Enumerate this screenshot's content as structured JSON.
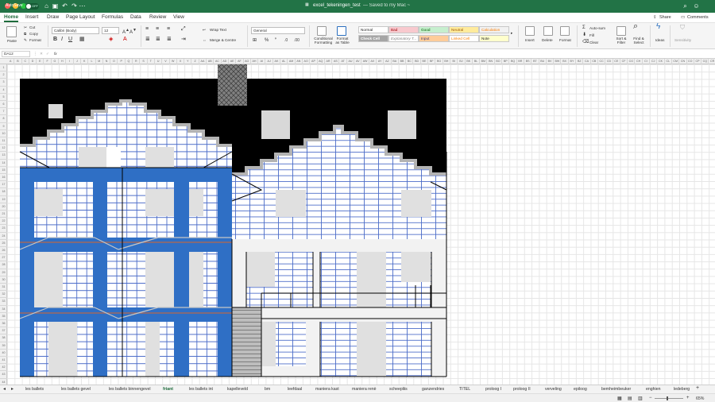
{
  "titlebar": {
    "autosave_label": "AutoSave",
    "autosave_state": "OFF",
    "title": "excel_tekeningen_test",
    "saved_status": "— Saved to my Mac ~",
    "colors": {
      "bar": "#227346"
    }
  },
  "menu": {
    "tabs": [
      "Home",
      "Insert",
      "Draw",
      "Page Layout",
      "Formulas",
      "Data",
      "Review",
      "View"
    ],
    "share": "Share",
    "comments": "Comments"
  },
  "ribbon": {
    "paste": "Paste",
    "cut": "Cut",
    "copy": "Copy",
    "format": "Format",
    "font_name": "Calibri (Body)",
    "font_size": "12",
    "wrap_text": "Wrap Text",
    "merge_centre": "Merge & Centre",
    "number_format": "General",
    "conditional_formatting": "Conditional Formatting",
    "format_as_table": "Format as Table",
    "styles": {
      "normal": "Normal",
      "bad": "Bad",
      "good": "Good",
      "neutral": "Neutral",
      "calculation": "Calculation",
      "check_cell": "Check Cell",
      "explanatory": "Explanatory T...",
      "input": "Input",
      "linked_cell": "Linked Cell",
      "note": "Note"
    },
    "insert": "Insert",
    "delete": "Delete",
    "format_cells": "Format",
    "autosum": "Auto-sum",
    "fill": "Fill",
    "clear": "Clear",
    "sort_filter": "Sort & Filter",
    "find_select": "Find & Select",
    "ideas": "Ideas",
    "sensitivity": "Sensitivity"
  },
  "formula_bar": {
    "cell_ref": "DA12",
    "fx": "fx",
    "value": ""
  },
  "grid": {
    "columns": [
      "A",
      "B",
      "C",
      "D",
      "E",
      "F",
      "G",
      "H",
      "I",
      "J",
      "K",
      "L",
      "M",
      "N",
      "O",
      "P",
      "Q",
      "R",
      "S",
      "T",
      "U",
      "V",
      "W",
      "X",
      "Y",
      "Z",
      "AA",
      "AB",
      "AC",
      "AD",
      "AE",
      "AF",
      "AG",
      "AH",
      "AI",
      "AJ",
      "AK",
      "AL",
      "AM",
      "AN",
      "AO",
      "AP",
      "AQ",
      "AR",
      "AS",
      "AT",
      "AU",
      "AV",
      "AW",
      "AX",
      "AY",
      "AZ",
      "BA",
      "BB",
      "BC",
      "BD",
      "BE",
      "BF",
      "BG",
      "BH",
      "BI",
      "BJ",
      "BK",
      "BL",
      "BM",
      "BN",
      "BO",
      "BP",
      "BQ",
      "BR",
      "BS",
      "BT",
      "BU",
      "BV",
      "BW",
      "BX",
      "BY",
      "BZ",
      "CA",
      "CB",
      "CC",
      "CD",
      "CE",
      "CF",
      "CG",
      "CH",
      "CI",
      "CJ",
      "CK",
      "CL",
      "CM",
      "CN",
      "CO",
      "CP",
      "CQ",
      "CR",
      "CS",
      "CT",
      "CU",
      "CV"
    ],
    "row_count": 44,
    "colors": {
      "black": "#000000",
      "blue": "#2f6fc5",
      "white_wall": "#f2f2f2",
      "window_grey": "#e0e0e0",
      "brick_line": "#4a6bc8",
      "rust": "#b8674a"
    }
  },
  "sheet_tabs": {
    "tabs": [
      "les ballets",
      "les ballets gevel",
      "les ballets binnengevel",
      "friant",
      "les ballets int",
      "kapelleveld",
      "bm",
      "leefdaal",
      "maniera kast",
      "maniera renè",
      "scheepliis",
      "ganzendries",
      "TITEL",
      "proloog I",
      "proloog II",
      "verveling",
      "epiloog",
      "bemheimbeuker",
      "enghien",
      "ledeberg"
    ],
    "active": "friant"
  },
  "status": {
    "zoom": "65%"
  }
}
